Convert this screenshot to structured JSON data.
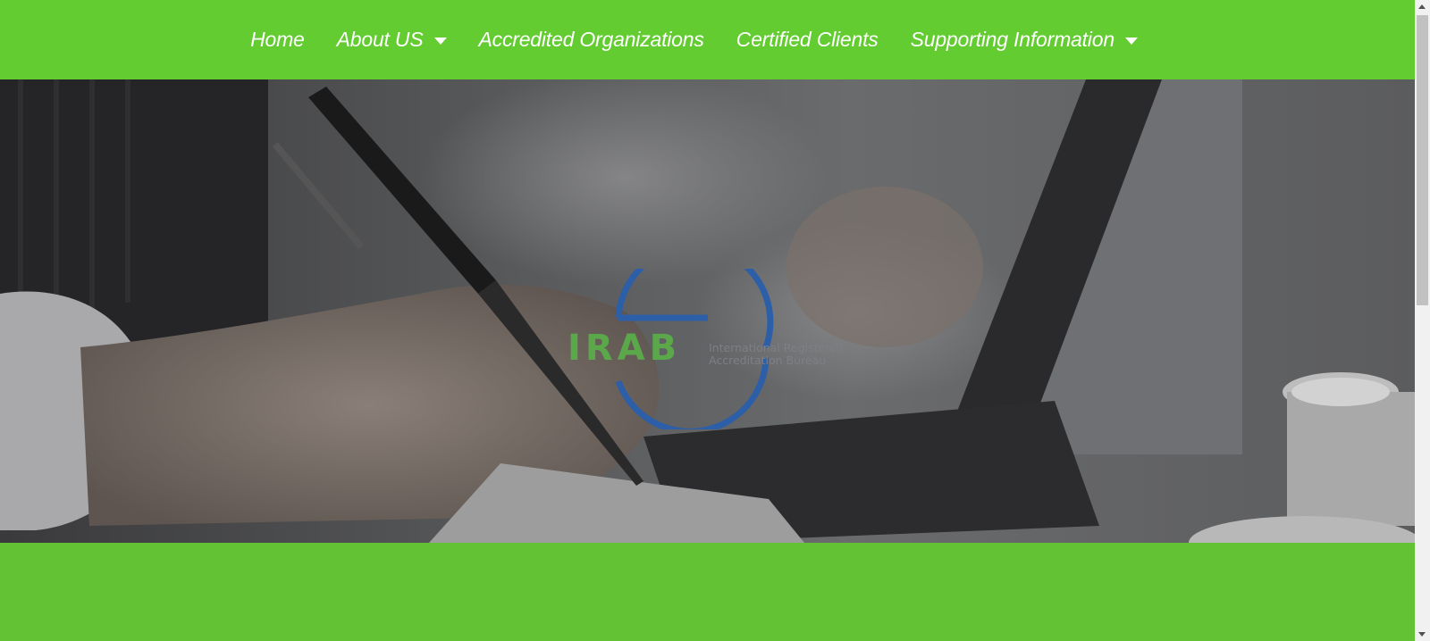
{
  "nav": {
    "items": [
      {
        "label": "Home",
        "dropdown": false
      },
      {
        "label": "About US",
        "dropdown": true
      },
      {
        "label": "Accredited Organizations",
        "dropdown": false
      },
      {
        "label": "Certified Clients",
        "dropdown": false
      },
      {
        "label": "Supporting Information",
        "dropdown": true
      }
    ]
  },
  "hero": {
    "logo": {
      "main": "IRAB",
      "sub_line1": "International Registered",
      "sub_line2": "Accreditation Bureau"
    }
  },
  "colors": {
    "nav_bg": "#62cc30",
    "band_bg": "#62c234",
    "logo_green": "#5aa84a",
    "logo_blue": "#2d5fa8"
  }
}
